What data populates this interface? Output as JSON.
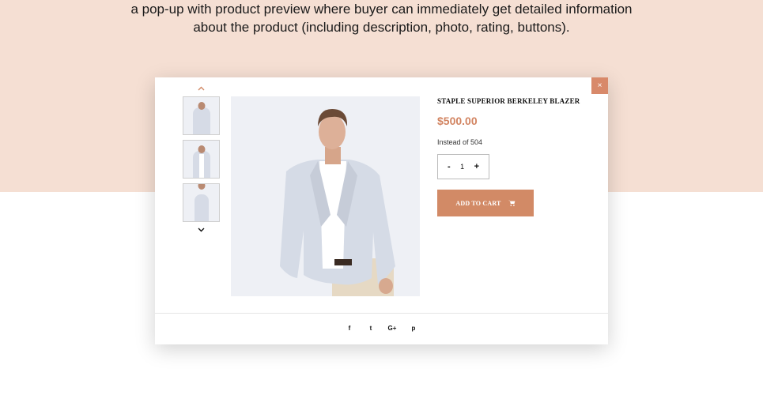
{
  "intro": {
    "line1": "a pop-up with product preview where buyer can immediately get detailed information",
    "line2": "about the product (including description, photo, rating, buttons)."
  },
  "modal": {
    "close_label": "×",
    "product_title": "STAPLE SUPERIOR BERKELEY BLAZER",
    "price": "$500.00",
    "instead_text": "Instead of 504",
    "quantity": {
      "minus": "-",
      "value": "1",
      "plus": "+"
    },
    "add_to_cart_label": "ADD TO CART",
    "thumbnails_count": 3,
    "social": [
      "f",
      "t",
      "G+",
      "p"
    ],
    "icons": {
      "thumb_up": "chevron-up-icon",
      "thumb_down": "chevron-down-icon",
      "cart": "cart-icon",
      "facebook": "facebook-icon",
      "twitter": "twitter-icon",
      "google_plus": "google-plus-icon",
      "pinterest": "pinterest-icon"
    }
  },
  "colors": {
    "peach_background": "#f5dfd3",
    "accent": "#d28a66",
    "price": "#d28461"
  }
}
